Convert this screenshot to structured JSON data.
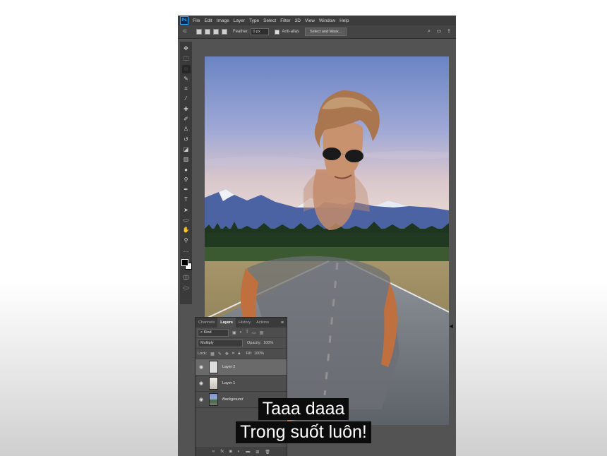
{
  "menubar": {
    "app_icon": "Ps",
    "items": [
      "File",
      "Edit",
      "Image",
      "Layer",
      "Type",
      "Select",
      "Filter",
      "3D",
      "View",
      "Window",
      "Help"
    ]
  },
  "options": {
    "feather_label": "Feather:",
    "feather_value": "0 px",
    "antialias_label": "Anti-alias",
    "select_mask_label": "Select and Mask..."
  },
  "layers_panel": {
    "tabs": [
      "Channels",
      "Layers",
      "History",
      "Actions"
    ],
    "kind_label": "Kind",
    "blend_mode": "Multiply",
    "opacity_label": "Opacity:",
    "opacity_value": "100%",
    "lock_label": "Lock:",
    "fill_label": "Fill:",
    "fill_value": "100%",
    "layers": [
      {
        "name": "Layer 2",
        "selected": true,
        "visible": true
      },
      {
        "name": "Layer 1",
        "selected": false,
        "visible": true
      },
      {
        "name": "Background",
        "selected": false,
        "visible": true
      }
    ]
  },
  "subtitles": {
    "line1": "Taaa daaa",
    "line2": "Trong suốt luôn!"
  },
  "colors": {
    "ps_accent": "#31a8ff",
    "interface_bg": "#535353",
    "sky_top": "#6e86c6",
    "foreground_swatch": "#000000",
    "background_swatch": "#ffffff"
  }
}
